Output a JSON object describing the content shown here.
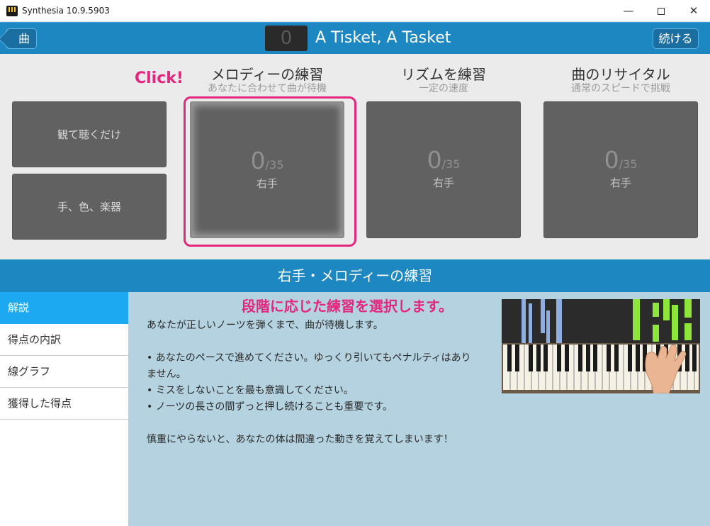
{
  "window": {
    "title": "Synthesia 10.9.5903",
    "minimize": "—",
    "close": "✕"
  },
  "header": {
    "back_label": "曲",
    "score": "0",
    "song_title": "A Tisket, A Tasket",
    "continue_label": "続ける"
  },
  "side_buttons": {
    "watch": "観て聴くだけ",
    "hands": "手、色、楽器"
  },
  "modes": [
    {
      "title": "メロディーの練習",
      "subtitle": "あなたに合わせて曲が待機",
      "score": "0",
      "total": "/35",
      "hand": "右手"
    },
    {
      "title": "リズムを練習",
      "subtitle": "一定の速度",
      "score": "0",
      "total": "/35",
      "hand": "右手"
    },
    {
      "title": "曲のリサイタル",
      "subtitle": "通常のスピードで挑戦",
      "score": "0",
      "total": "/35",
      "hand": "右手"
    }
  ],
  "annotations": {
    "click": "Click!",
    "select": "段階に応じた練習を選択します。"
  },
  "section_title": "右手・メロディーの練習",
  "nav": [
    "解説",
    "得点の内訳",
    "線グラフ",
    "獲得した得点"
  ],
  "description": {
    "line1": "あなたが正しいノーツを弾くまで、曲が待機します。",
    "bullet1": "• あなたのペースで進めてください。ゆっくり引いてもペナルティはありません。",
    "bullet2": "• ミスをしないことを最も意識してください。",
    "bullet3": "• ノーツの長さの間ずっと押し続けることも重要です。",
    "closing": "慎重にやらないと、あなたの体は間違った動きを覚えてしまいます！"
  },
  "colors": {
    "header_blue": "#1d87c2",
    "nav_active": "#1da8f2",
    "content_bg": "#b4d2df",
    "annotation_pink": "#e2277f",
    "note_blue": "#8eaee0",
    "note_green": "#8ee63a"
  }
}
